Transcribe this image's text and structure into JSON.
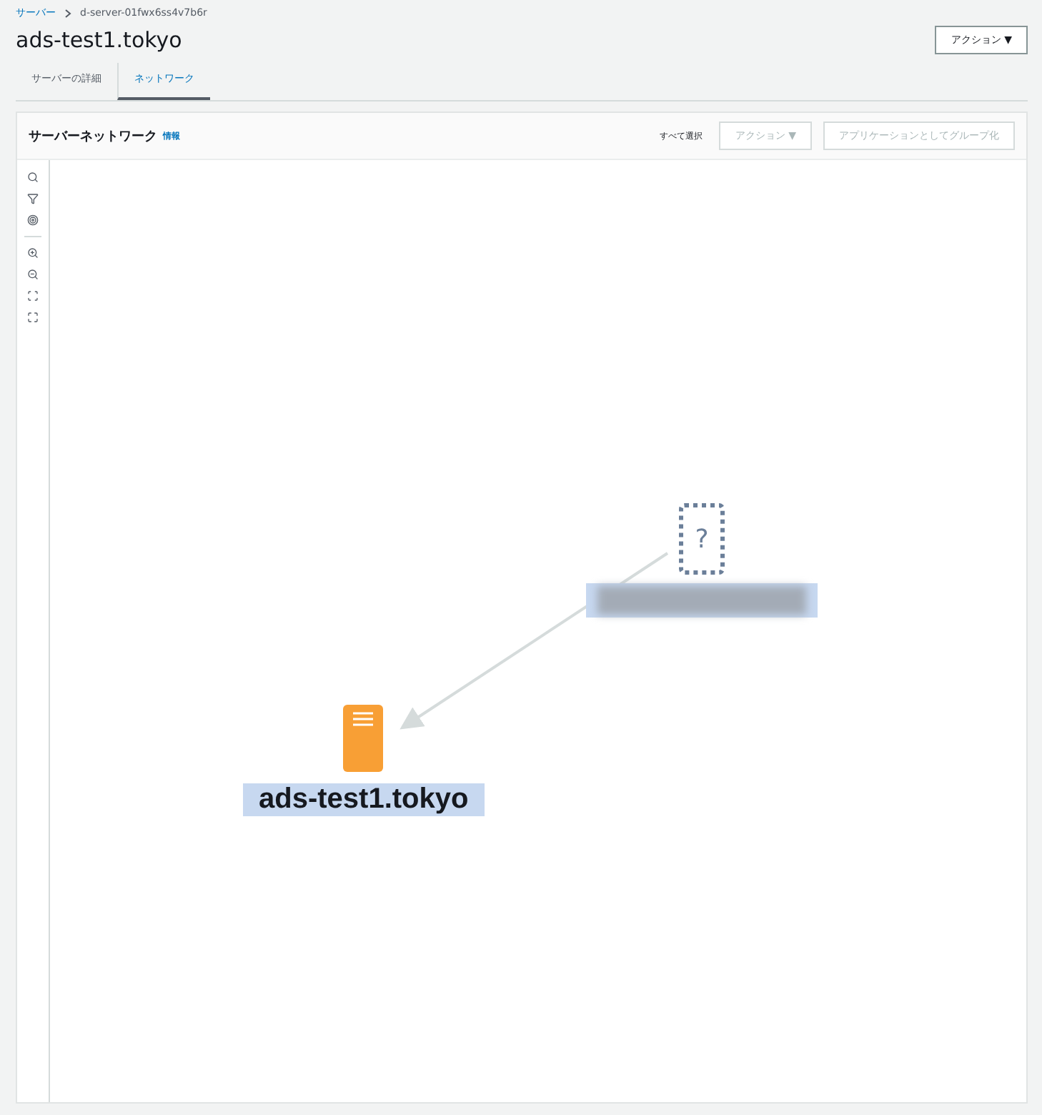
{
  "breadcrumb": [
    {
      "label": "サーバー",
      "link": true
    },
    {
      "label": "d-server-01fwx6ss4v7b6r",
      "link": false
    }
  ],
  "title": "ads-test1.tokyo",
  "header_action": "アクション ▼",
  "tabs": [
    {
      "label": "サーバーの詳細",
      "selected": false
    },
    {
      "label": "ネットワーク",
      "selected": true
    }
  ],
  "panel": {
    "title": "サーバーネットワーク",
    "info": "情報",
    "select_all": "すべて選択",
    "buttons": [
      {
        "label": "アクション ▼",
        "disabled": true
      },
      {
        "label": "アプリケーションとしてグループ化",
        "disabled": true
      }
    ]
  },
  "tools": [
    {
      "kind": "search"
    },
    {
      "kind": "filter"
    },
    {
      "kind": "target"
    },
    {
      "kind": "divider"
    },
    {
      "kind": "zoom-in"
    },
    {
      "kind": "zoom-out"
    },
    {
      "kind": "fit"
    },
    {
      "kind": "expand"
    }
  ],
  "nodes": [
    {
      "kind": "unknown",
      "glyph": "?",
      "label_redacted": true
    },
    {
      "kind": "server",
      "label": "ads-test1.tokyo"
    }
  ]
}
